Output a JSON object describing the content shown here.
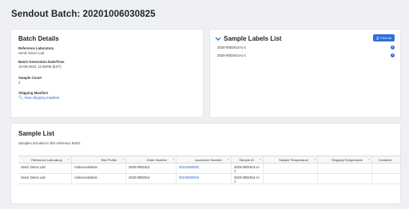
{
  "page": {
    "title": "Sendout Batch: 20201006030825"
  },
  "batch_details": {
    "title": "Batch Details",
    "fields": [
      {
        "label": "Reference Laboratory",
        "value": "Send: Demo Lab"
      },
      {
        "label": "Batch Generation Date/Time",
        "value": "10-05-2020, 11:55PM (EST)"
      },
      {
        "label": "Sample Count",
        "value": "2"
      },
      {
        "label": "Shipping Manifest",
        "value": "View shipping manifest"
      }
    ]
  },
  "sample_labels": {
    "title": "Sample Labels List",
    "print_all_label": "Print All",
    "items": [
      "2020-0002913-U-1",
      "2020-0002914-U-1"
    ]
  },
  "sample_list": {
    "title": "Sample List",
    "subtitle": "Samples included in this reference batch.",
    "columns": [
      "Reference Laboratory",
      "Test Profile",
      "Order Number",
      "Accession Number",
      "Sample ID",
      "Sample Temperature",
      "Shipping Temperature",
      "Container"
    ],
    "rows": [
      [
        "Send: Demo Lab",
        "Anticonvulsants",
        "2020-0002913",
        "20102600002",
        "2020-0002913-U-1",
        "",
        "",
        ""
      ],
      [
        "Send: Demo Lab",
        "Anticonvulsants",
        "2020-0002914",
        "20102600003",
        "2020-0002914-U-1",
        "",
        "",
        ""
      ]
    ]
  },
  "colors": {
    "accent": "#2f6fdb",
    "link": "#2a62c9",
    "background": "#eef0f3"
  }
}
